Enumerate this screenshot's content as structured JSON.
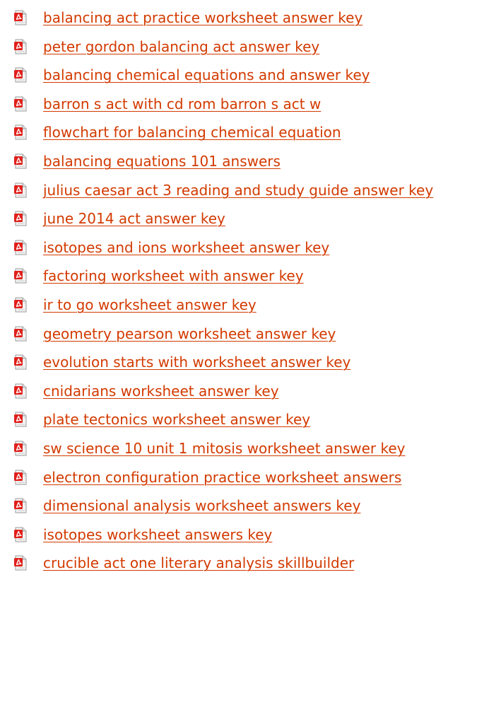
{
  "links": [
    {
      "label": "balancing act practice worksheet answer key",
      "icon": "pdf-file-icon"
    },
    {
      "label": "peter gordon balancing act answer key",
      "icon": "pdf-file-icon"
    },
    {
      "label": "balancing chemical equations and answer key",
      "icon": "pdf-file-icon"
    },
    {
      "label": "barron s act with cd rom barron s act w",
      "icon": "pdf-file-icon"
    },
    {
      "label": "flowchart for balancing chemical equation",
      "icon": "pdf-file-icon"
    },
    {
      "label": "balancing equations 101 answers",
      "icon": "pdf-file-icon"
    },
    {
      "label": "julius caesar act 3 reading and study guide answer key",
      "icon": "pdf-file-icon"
    },
    {
      "label": "june 2014 act answer key",
      "icon": "pdf-file-icon"
    },
    {
      "label": "isotopes and ions worksheet answer key",
      "icon": "pdf-file-icon"
    },
    {
      "label": "factoring worksheet with answer key",
      "icon": "pdf-file-icon"
    },
    {
      "label": "ir to go worksheet answer key",
      "icon": "pdf-file-icon"
    },
    {
      "label": "geometry pearson worksheet answer key",
      "icon": "pdf-file-icon"
    },
    {
      "label": "evolution starts with worksheet answer key",
      "icon": "pdf-file-icon"
    },
    {
      "label": "cnidarians worksheet answer key",
      "icon": "pdf-file-icon"
    },
    {
      "label": "plate tectonics worksheet answer key",
      "icon": "pdf-file-icon"
    },
    {
      "label": "sw science 10 unit 1 mitosis worksheet answer key",
      "icon": "pdf-file-icon"
    },
    {
      "label": "electron configuration practice worksheet answers",
      "icon": "pdf-file-icon"
    },
    {
      "label": "dimensional analysis worksheet answers key",
      "icon": "pdf-file-icon"
    },
    {
      "label": "isotopes worksheet answers key",
      "icon": "pdf-file-icon"
    },
    {
      "label": "crucible act one literary analysis skillbuilder",
      "icon": "pdf-file-icon"
    }
  ],
  "colors": {
    "link": "#d33a00",
    "icon_red": "#e0201b",
    "icon_page": "#f4f4f4",
    "icon_border": "#9a9a9a"
  }
}
